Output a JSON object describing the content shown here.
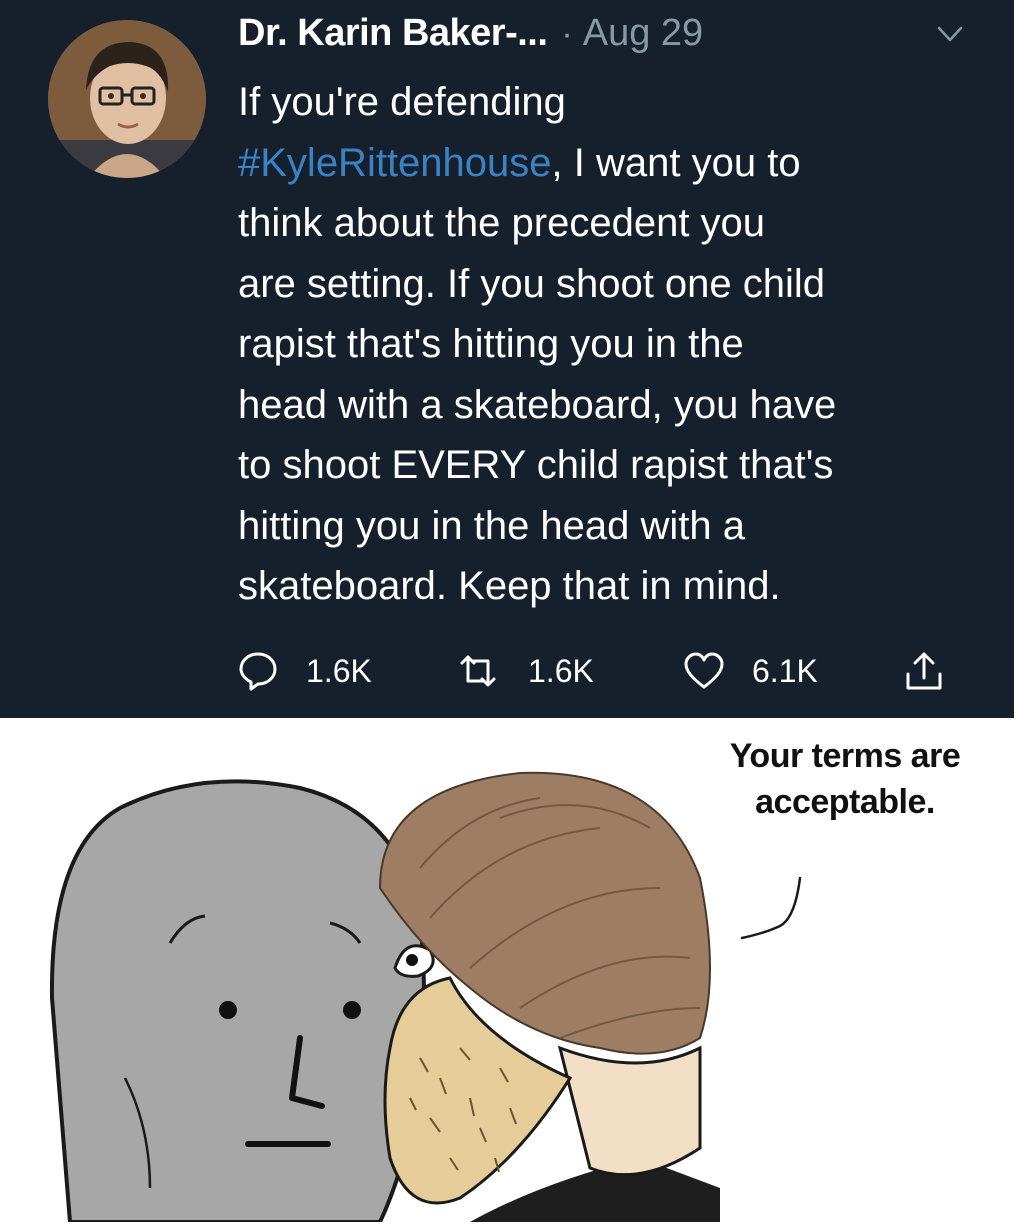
{
  "tweet": {
    "author": "Dr. Karin Baker-...",
    "separator": "·",
    "date": "Aug 29",
    "icons": {
      "menu": "chevron-down-icon",
      "reply": "speech-bubble-icon",
      "retweet": "retweet-icon",
      "like": "heart-icon",
      "share": "share-icon"
    },
    "body": {
      "line1": "If you're defending",
      "hashtag": "#KyleRittenhouse",
      "line2_rest": ", I want you to",
      "line3": "think about the precedent you",
      "line4": "are setting. If you shoot one child",
      "line5": "rapist that's hitting you in the",
      "line6": "head with a skateboard, you have",
      "line7": "to shoot EVERY child rapist that's",
      "line8": "hitting you in the head with a",
      "line9": "skateboard. Keep that in mind."
    },
    "actions": {
      "replies": "1.6K",
      "retweets": "1.6K",
      "likes": "6.1K"
    },
    "colors": {
      "background": "#16202c",
      "text": "#ffffff",
      "muted": "#8899a6",
      "hashtag": "#3a82c4"
    }
  },
  "meme": {
    "speech_line1": "Your terms are",
    "speech_line2": "acceptable."
  }
}
